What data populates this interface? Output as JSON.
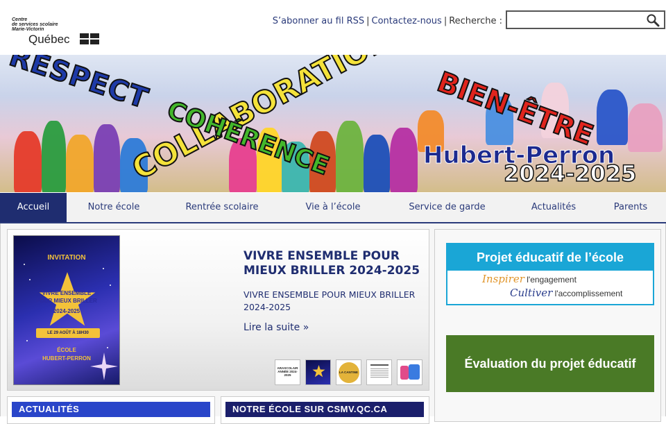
{
  "header": {
    "logo": {
      "line1": "Centre",
      "line2": "de services scolaire",
      "line3": "Marie-Victorin",
      "wordmark": "Québec"
    },
    "links": [
      "S’abonner au fil RSS",
      "Contactez-nous",
      "Recherche :"
    ],
    "link_separator": "|",
    "search": {
      "value": "",
      "placeholder": ""
    }
  },
  "banner": {
    "words": [
      "RESPECT",
      "COLLABORATION",
      "COHÉRENCE",
      "BIEN-ÊTRE"
    ],
    "school": "Hubert-Perron",
    "year": "2024-2025"
  },
  "nav": {
    "tabs": [
      "Accueil",
      "Notre école",
      "Rentrée scolaire",
      "Vie à l’école",
      "Service de garde",
      "Actualités",
      "Parents"
    ],
    "active_index": 0
  },
  "feature": {
    "title": "VIVRE ENSEMBLE POUR MIEUX BRILLER 2024-2025",
    "description": "VIVRE ENSEMBLE POUR MIEUX BRILLER 2024-2025",
    "read_more": "Lire la suite »",
    "poster": {
      "invite": "INVITATION",
      "line1": "VIVRE ENSEMBLE",
      "line2": "POUR MIEUX BRILLER",
      "line3": "2024-2025",
      "date": "LE 29 AOÛT À 18H30",
      "school1": "ÉCOLE",
      "school2": "HUBERT-PERRON"
    },
    "thumbnails": [
      {
        "label": "ARASCOLAIR ANNÉE 2024-2025"
      },
      {
        "label": ""
      },
      {
        "label": "LA CANTINE"
      },
      {
        "label": ""
      },
      {
        "label": ""
      }
    ]
  },
  "sidebar": {
    "project": {
      "title": "Projet éducatif de l’école",
      "line1_em": "Inspirer",
      "line1_rest": " l'engagement",
      "line2_em": "Cultiver",
      "line2_rest": " l'accomplissement"
    },
    "evaluation": "Évaluation du projet éducatif"
  },
  "boxes": {
    "news": "ACTUALITÉS",
    "csmv": "NOTRE ÉCOLE SUR CSMV.QC.CA"
  },
  "colors": {
    "primary": "#1f2d70",
    "news_header": "#2945c9",
    "csmv_header": "#1b1f6b",
    "project_blue": "#1aa6d6",
    "eval_green": "#4a7a26"
  }
}
